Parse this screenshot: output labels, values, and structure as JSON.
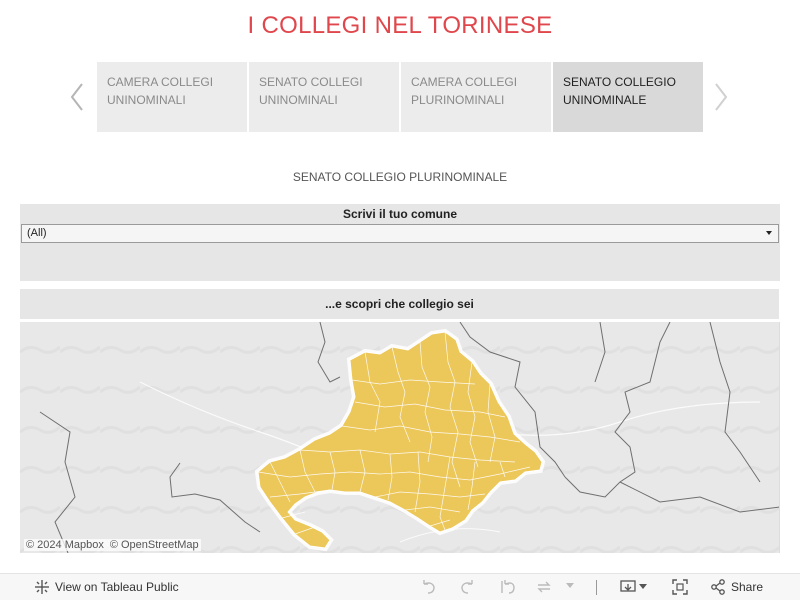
{
  "title": "I COLLEGI NEL TORINESE",
  "story": {
    "tabs": [
      {
        "line1": "CAMERA COLLEGI",
        "line2": "UNINOMINALI",
        "active": false
      },
      {
        "line1": "SENATO COLLEGI",
        "line2": "UNINOMINALI",
        "active": false
      },
      {
        "line1": "CAMERA COLLEGI",
        "line2": "PLURINOMINALI",
        "active": false
      },
      {
        "line1": "SENATO COLLEGIO",
        "line2": "UNINOMINALE",
        "active": true
      }
    ]
  },
  "subtitle": "SENATO COLLEGIO PLURINOMINALE",
  "filter": {
    "label": "Scrivi il tuo comune",
    "value": "(All)"
  },
  "map": {
    "header": "...e scopri che collegio sei",
    "attribution_mapbox": "© 2024 Mapbox",
    "attribution_osm": "© OpenStreetMap",
    "region_color": "#ecc75a",
    "background_color": "#e9e9e9"
  },
  "toolbar": {
    "view_label": "View on Tableau Public",
    "share_label": "Share"
  },
  "colors": {
    "title": "#e0474c",
    "tab_bg": "#ececec",
    "tab_active_bg": "#d9d9d9"
  }
}
